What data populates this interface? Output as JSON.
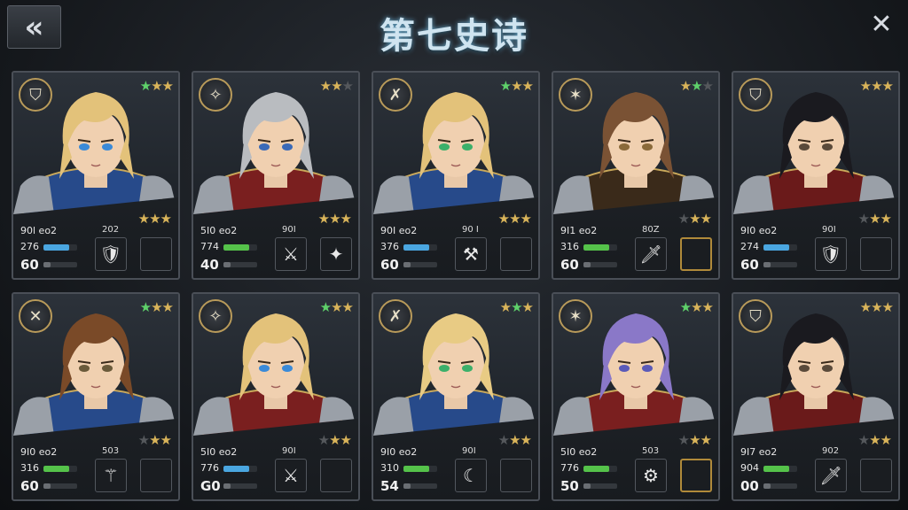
{
  "header": {
    "back_icon": "double-chevron-left-icon",
    "back_glyph": "«",
    "title": "第七史诗",
    "close_glyph": "✕"
  },
  "colors": {
    "hp_blue": "#4aa6e0",
    "hp_green": "#55c24a",
    "gold_frame": "#b08a3a"
  },
  "heroes": [
    {
      "emblem": "⛉",
      "emblem_name": "shield-icon",
      "top_stars": [
        "g",
        "y",
        "y"
      ],
      "mid_stars": [
        "y",
        "y",
        "y"
      ],
      "stat_label": "90l eo2",
      "hp": "276",
      "bar": "blue",
      "level": "60",
      "item_label": "202",
      "item1": "🛡",
      "item1_name": "gold-shield-icon",
      "item2": "",
      "item2_name": "empty-slot",
      "gold": false,
      "hair": "#e3c27a",
      "eye": "#3a8ad8",
      "armor": "#274a8a"
    },
    {
      "emblem": "✧",
      "emblem_name": "winged-helm-icon",
      "top_stars": [
        "y",
        "y",
        "d"
      ],
      "mid_stars": [
        "y",
        "y",
        "y"
      ],
      "stat_label": "5I0 eo2",
      "hp": "774",
      "bar": "green",
      "level": "40",
      "item_label": "90I",
      "item1": "⚔",
      "item1_name": "trident-icon",
      "item2": "✦",
      "item2_name": "crystal-blade-icon",
      "gold": false,
      "hair": "#b9bcc0",
      "eye": "#3a6ab8",
      "armor": "#7a1f1f"
    },
    {
      "emblem": "✗",
      "emblem_name": "crossed-swords-icon",
      "top_stars": [
        "g",
        "y",
        "y"
      ],
      "mid_stars": [
        "y",
        "y",
        "y"
      ],
      "stat_label": "90I eo2",
      "hp": "376",
      "bar": "blue",
      "level": "60",
      "item_label": "90 I",
      "item1": "⚒",
      "item1_name": "gauntlet-icon",
      "item2": "",
      "item2_name": "empty-slot",
      "gold": false,
      "hair": "#e3c27a",
      "eye": "#3bb06a",
      "armor": "#274a8a"
    },
    {
      "emblem": "✶",
      "emblem_name": "star-burst-icon",
      "top_stars": [
        "y",
        "g",
        "d"
      ],
      "mid_stars": [
        "d",
        "y",
        "y"
      ],
      "stat_label": "9I1 eo2",
      "hp": "316",
      "bar": "green",
      "level": "60",
      "item_label": "80Z",
      "item1": "🗡",
      "item1_name": "dagger-icon",
      "item2": "",
      "item2_name": "empty-slot",
      "gold": true,
      "hair": "#7a5234",
      "eye": "#8a6a3a",
      "armor": "#3a2a1a"
    },
    {
      "emblem": "⛉",
      "emblem_name": "shield-icon",
      "top_stars": [
        "y",
        "y",
        "y"
      ],
      "mid_stars": [
        "d",
        "y",
        "y"
      ],
      "stat_label": "9I0 eo2",
      "hp": "274",
      "bar": "blue",
      "level": "60",
      "item_label": "90I",
      "item1": "🛡",
      "item1_name": "red-shield-icon",
      "item2": "",
      "item2_name": "empty-slot",
      "gold": false,
      "hair": "#1a1a1f",
      "eye": "#5a4a3a",
      "armor": "#6a1a1a"
    },
    {
      "emblem": "✕",
      "emblem_name": "crossed-axes-icon",
      "top_stars": [
        "g",
        "y",
        "y"
      ],
      "mid_stars": [
        "d",
        "y",
        "y"
      ],
      "stat_label": "9I0 eo2",
      "hp": "316",
      "bar": "green",
      "level": "60",
      "item_label": "503",
      "item1": "⚚",
      "item1_name": "staff-icon",
      "item2": "",
      "item2_name": "empty-slot",
      "gold": false,
      "hair": "#7a4a28",
      "eye": "#6a5a3a",
      "armor": "#274a8a"
    },
    {
      "emblem": "✧",
      "emblem_name": "winged-helm-icon",
      "top_stars": [
        "g",
        "y",
        "y"
      ],
      "mid_stars": [
        "d",
        "y",
        "y"
      ],
      "stat_label": "5I0 eo2",
      "hp": "776",
      "bar": "blue",
      "level": "G0",
      "item_label": "90I",
      "item1": "⚔",
      "item1_name": "spear-icon",
      "item2": "",
      "item2_name": "empty-slot",
      "gold": false,
      "hair": "#e3c27a",
      "eye": "#3a8ad8",
      "armor": "#7a1f1f"
    },
    {
      "emblem": "✗",
      "emblem_name": "crossed-swords-icon",
      "top_stars": [
        "y",
        "g",
        "y"
      ],
      "mid_stars": [
        "d",
        "y",
        "y"
      ],
      "stat_label": "9I0 eo2",
      "hp": "310",
      "bar": "green",
      "level": "54",
      "item_label": "90I",
      "item1": "☾",
      "item1_name": "crescent-blade-icon",
      "item2": "",
      "item2_name": "empty-slot",
      "gold": false,
      "hair": "#e8cb84",
      "eye": "#3bb06a",
      "armor": "#274a8a"
    },
    {
      "emblem": "✶",
      "emblem_name": "star-burst-icon",
      "top_stars": [
        "g",
        "y",
        "y"
      ],
      "mid_stars": [
        "d",
        "y",
        "y"
      ],
      "stat_label": "5I0 eo2",
      "hp": "776",
      "bar": "green",
      "level": "50",
      "item_label": "503",
      "item1": "⚙",
      "item1_name": "round-shield-icon",
      "item2": "",
      "item2_name": "empty-slot",
      "gold": true,
      "hair": "#8a78c8",
      "eye": "#5a5ab8",
      "armor": "#7a1f1f"
    },
    {
      "emblem": "⛉",
      "emblem_name": "shield-icon",
      "top_stars": [
        "y",
        "y",
        "y"
      ],
      "mid_stars": [
        "d",
        "y",
        "y"
      ],
      "stat_label": "9I7 eo2",
      "hp": "904",
      "bar": "green",
      "level": "00",
      "item_label": "902",
      "item1": "🗡",
      "item1_name": "sword-icon",
      "item2": "",
      "item2_name": "empty-slot",
      "gold": false,
      "hair": "#1a1a1f",
      "eye": "#5a4a3a",
      "armor": "#6a1a1a"
    }
  ]
}
